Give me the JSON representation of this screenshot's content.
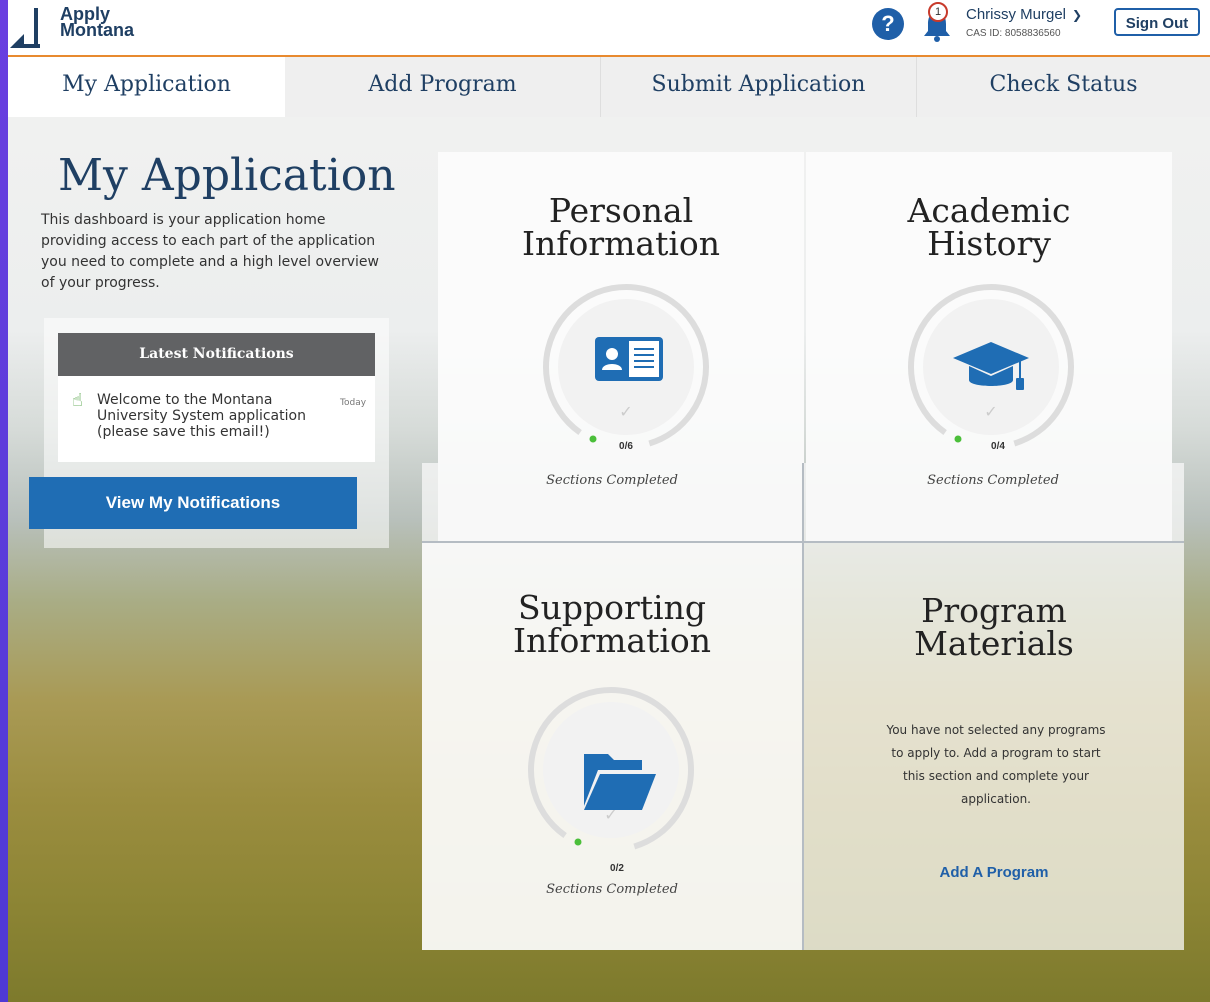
{
  "header": {
    "logo_line1": "Apply",
    "logo_line2": "Montana",
    "help_symbol": "?",
    "notification_count": "1",
    "user_name": "Chrissy Murgel",
    "cas_id": "CAS ID: 8058836560",
    "sign_out_label": "Sign Out",
    "accent_color": "#e88a2f"
  },
  "tabs": [
    {
      "label": "My Application",
      "active": true
    },
    {
      "label": "Add Program",
      "active": false
    },
    {
      "label": "Submit Application",
      "active": false
    },
    {
      "label": "Check Status",
      "active": false
    }
  ],
  "main": {
    "title": "My Application",
    "intro": "This dashboard is your application home providing access to each part of the application you need to complete and a high level overview of your progress."
  },
  "notifications": {
    "heading": "Latest Notifications",
    "items": [
      {
        "text": "Welcome to the Montana University System application (please save this email!)",
        "date": "Today",
        "icon": "hand-pointer-icon"
      }
    ],
    "view_button": "View My Notifications"
  },
  "cards": {
    "personal": {
      "title_line1": "Personal",
      "title_line2": "Information",
      "count": "0/6",
      "label": "Sections Completed",
      "icon": "id-card-icon"
    },
    "academic": {
      "title_line1": "Academic",
      "title_line2": "History",
      "count": "0/4",
      "label": "Sections Completed",
      "icon": "graduation-cap-icon"
    },
    "supporting": {
      "title_line1": "Supporting",
      "title_line2": "Information",
      "count": "0/2",
      "label": "Sections Completed",
      "icon": "folder-icon"
    },
    "program": {
      "title_line1": "Program",
      "title_line2": "Materials",
      "text": "You have not selected any programs to apply to. Add a program to start this section and complete your application.",
      "link": "Add A Program"
    }
  },
  "colors": {
    "primary": "#1f6db4",
    "navy": "#1f3f63",
    "progress_dot": "#4bbf3a"
  }
}
